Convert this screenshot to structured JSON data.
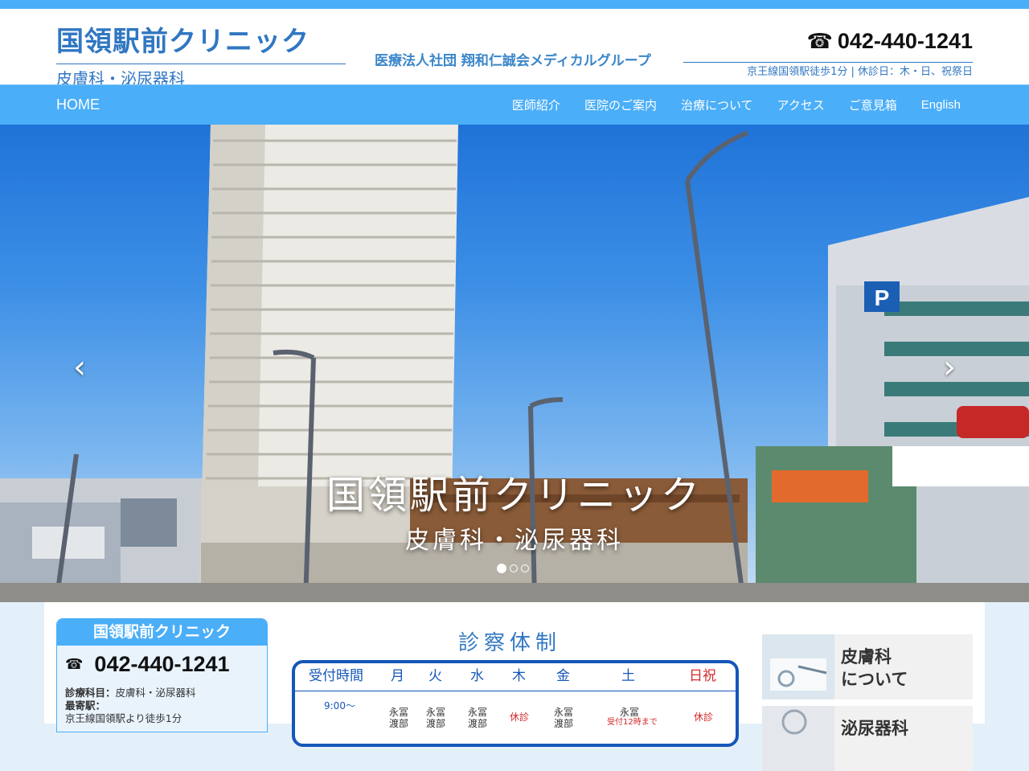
{
  "header": {
    "clinic_name": "国領駅前クリニック",
    "departments": "皮膚科・泌尿器科",
    "group_name": "医療法人社団 翔和仁誠会メディカルグループ",
    "phone": "042-440-1241",
    "access_info": "京王線国領駅徒歩1分 | 休診日：木・日、祝祭日"
  },
  "nav": {
    "home": "HOME",
    "links": [
      "医師紹介",
      "医院のご案内",
      "治療について",
      "アクセス",
      "ご意見箱",
      "English"
    ]
  },
  "hero": {
    "title": "国領駅前クリニック",
    "subtitle": "皮膚科・泌尿器科",
    "prev_icon": "chevron-left-icon",
    "next_icon": "chevron-right-icon",
    "slide_count": 3,
    "active_slide": 1
  },
  "info_card": {
    "title": "国領駅前クリニック",
    "phone": "042-440-1241",
    "dept_label": "診療科目：",
    "dept_value": "皮膚科・泌尿器科",
    "station_label": "最寄駅：",
    "station_value": "京王線国領駅より徒歩1分"
  },
  "schedule": {
    "heading": "診察体制",
    "columns": [
      "受付時間",
      "月",
      "火",
      "水",
      "木",
      "金",
      "土",
      "日祝"
    ],
    "row1": {
      "time": "9:00〜",
      "mon": [
        "永冨",
        "渡部"
      ],
      "tue": [
        "永冨",
        "渡部"
      ],
      "wed": [
        "永冨",
        "渡部"
      ],
      "thu": "休診",
      "fri": [
        "永冨",
        "渡部"
      ],
      "sat": [
        "永冨",
        "受付12時まで"
      ],
      "sun": "休診"
    }
  },
  "banners": [
    {
      "label_line1": "皮膚科",
      "label_line2": "について"
    },
    {
      "label_line1": "泌尿器科",
      "label_line2": ""
    }
  ],
  "colors": {
    "accent": "#4aaef8",
    "brand_text": "#3077c2",
    "schedule_border": "#1556b8",
    "closed_red": "#d12a2a"
  }
}
